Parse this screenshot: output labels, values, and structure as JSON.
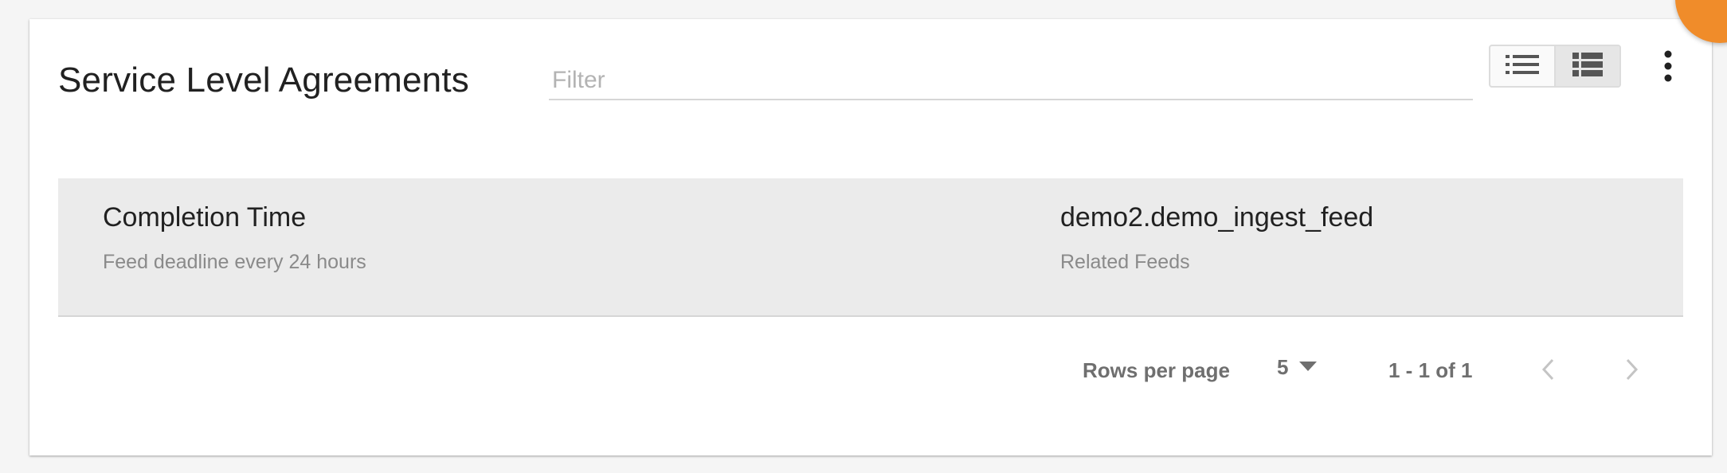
{
  "header": {
    "title": "Service Level Agreements",
    "filter_placeholder": "Filter",
    "filter_value": ""
  },
  "view_toggle": {
    "options": [
      {
        "icon": "list-view-icon",
        "active": false
      },
      {
        "icon": "table-view-icon",
        "active": true
      }
    ]
  },
  "menu": {
    "icon": "more-vert-icon"
  },
  "items": [
    {
      "name": "Completion Time",
      "description": "Feed deadline every 24 hours",
      "feed": "demo2.demo_ingest_feed",
      "feed_label": "Related Feeds"
    }
  ],
  "pagination": {
    "rows_per_page_label": "Rows per page",
    "rows_per_page": "5",
    "range": "1 - 1 of 1"
  },
  "colors": {
    "accent": "#f08c2a",
    "row_background": "#ebebeb",
    "secondary_text": "#8a8a8a"
  }
}
